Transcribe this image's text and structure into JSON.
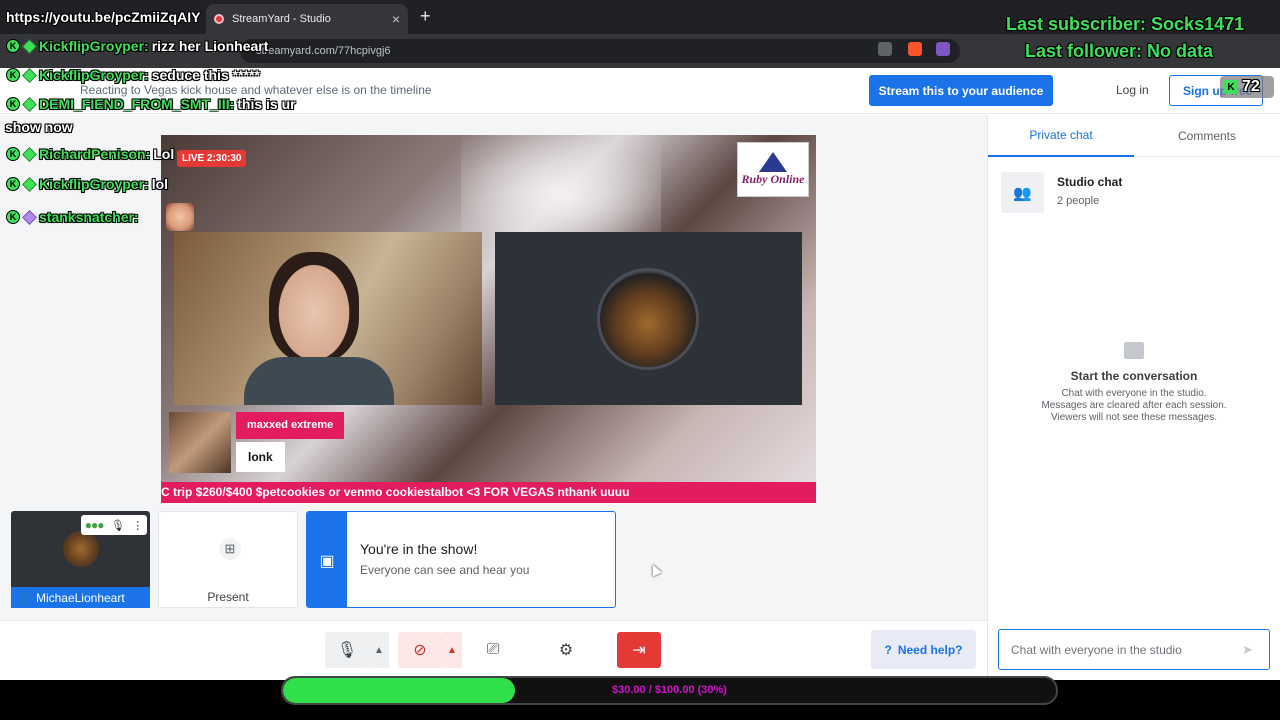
{
  "browser": {
    "tab_title": "StreamYard - Studio",
    "new_tab": "+",
    "tab_close": "×",
    "url": "streamyard.com/77hcpivgj6"
  },
  "header": {
    "description": "Reacting to Vegas kick house and whatever else is on the timeline",
    "stream_button": "Stream this to your audience",
    "login": "Log in",
    "signup": "Sign up free"
  },
  "stage": {
    "live_badge": "LIVE 2:30:30",
    "logo_text": "Ruby Online",
    "comment_name": "maxxed extreme",
    "comment_text": "lonk",
    "ticker": "C trip $260/$400 $petcookies or venmo cookiestalbot <3 FOR VEGAS nthank uuuu"
  },
  "participants": {
    "self_name": "MichaeLionheart",
    "present_label": "Present",
    "toast_title": "You're in the show!",
    "toast_subtitle": "Everyone can see and hear you"
  },
  "controls": {
    "help": "Need help?"
  },
  "chat_panel": {
    "tab_private": "Private chat",
    "tab_comments": "Comments",
    "chat_title": "Studio chat",
    "chat_subtitle": "2 people",
    "empty_title": "Start the conversation",
    "empty_line1": "Chat with everyone in the studio.",
    "empty_line2": "Messages are cleared after each session.",
    "empty_line3": "Viewers will not see these messages.",
    "input_placeholder": "Chat with everyone in the studio"
  },
  "donation": {
    "text": "$30.00 / $100.00 (30%)",
    "progress": 0.3,
    "fill_color": "#2fe04a",
    "text_color": "#d011c9"
  },
  "overlay": {
    "youtube_url": "https://youtu.be/pcZmiiZqAIY",
    "last_subscriber": "Last subscriber: Socks1471",
    "last_follower": "Last follower: No data",
    "viewer_count": "72",
    "chat": [
      {
        "user": "KickflipGroyper:",
        "message": "rizz her Lionheart",
        "badge": "green"
      },
      {
        "user": "KickflipGroyper:",
        "message": "seduce this *****",
        "badge": "green"
      },
      {
        "user": "DEMI_FIEND_FROM_SMT_III:",
        "message": "this is ur",
        "badge": "green"
      },
      {
        "user": "RichardPenison:",
        "message": "Lol",
        "badge": "green"
      },
      {
        "user": "KickflipGroyper:",
        "message": "lol",
        "badge": "green"
      },
      {
        "user": "stanksnatcher:",
        "message": "",
        "badge": "purple"
      }
    ],
    "chat_continuation": "show now"
  },
  "colors": {
    "accent": "#1a73e8",
    "live_red": "#e53935",
    "comment_pink": "#e31c5f",
    "overlay_green": "#3ee05a"
  }
}
